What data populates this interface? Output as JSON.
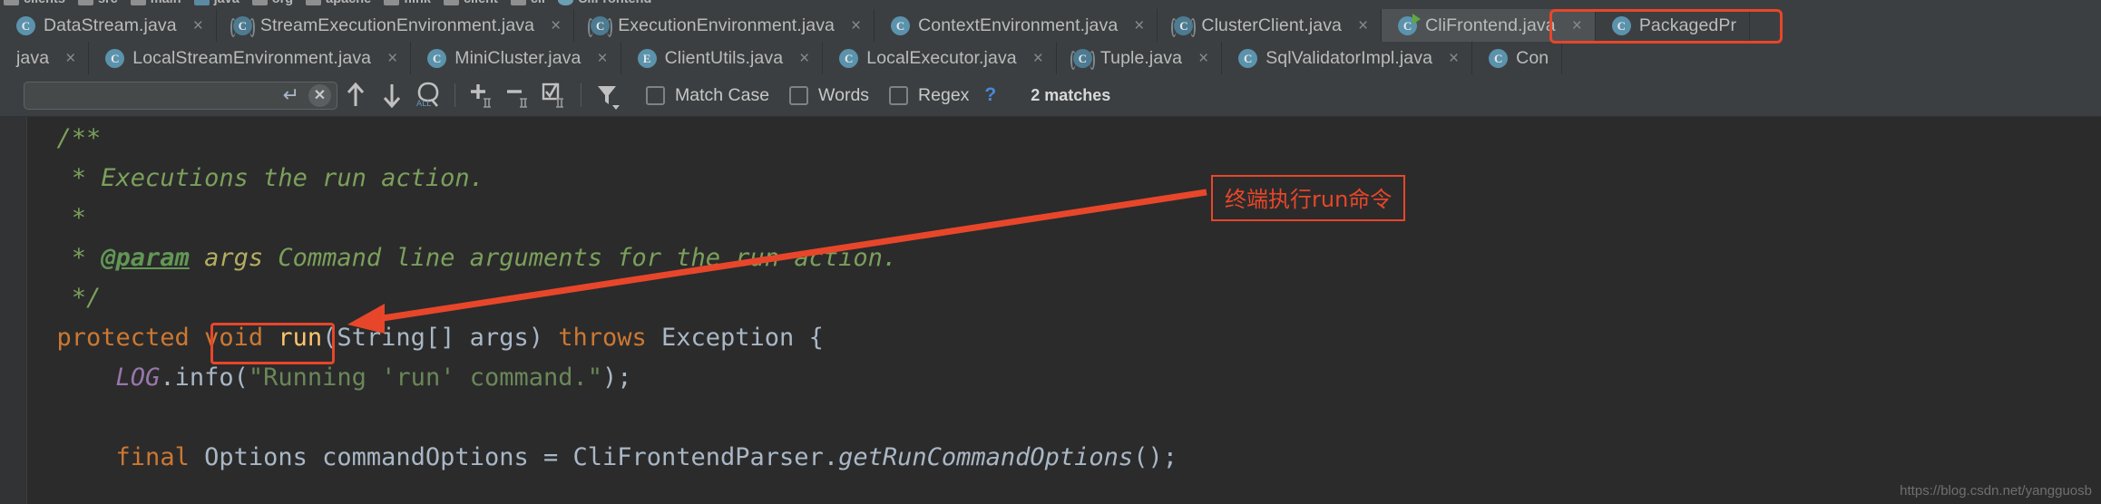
{
  "breadcrumb": {
    "items": [
      {
        "label": "clients",
        "icon": "folder-icon",
        "kind": "module"
      },
      {
        "label": "src",
        "icon": "folder-icon",
        "kind": "plain"
      },
      {
        "label": "main",
        "icon": "folder-icon",
        "kind": "plain"
      },
      {
        "label": "java",
        "icon": "source-folder-icon",
        "kind": "source"
      },
      {
        "label": "org",
        "icon": "folder-icon",
        "kind": "plain"
      },
      {
        "label": "apache",
        "icon": "folder-icon",
        "kind": "plain"
      },
      {
        "label": "flink",
        "icon": "folder-icon",
        "kind": "plain"
      },
      {
        "label": "client",
        "icon": "folder-icon",
        "kind": "plain"
      },
      {
        "label": "cli",
        "icon": "folder-icon",
        "kind": "plain"
      },
      {
        "label": "CliFrontend",
        "icon": "class-icon",
        "kind": "class"
      }
    ]
  },
  "tabs": {
    "row1": [
      {
        "label": "DataStream.java",
        "icon": "class-icon",
        "type": "class",
        "active": false,
        "close": "×"
      },
      {
        "label": "StreamExecutionEnvironment.java",
        "icon": "abstract-class-icon",
        "type": "abstract",
        "active": false,
        "close": "×"
      },
      {
        "label": "ExecutionEnvironment.java",
        "icon": "abstract-class-icon",
        "type": "abstract",
        "active": false,
        "close": "×"
      },
      {
        "label": "ContextEnvironment.java",
        "icon": "class-icon",
        "type": "class",
        "active": false,
        "close": "×"
      },
      {
        "label": "ClusterClient.java",
        "icon": "abstract-class-icon",
        "type": "abstract",
        "active": false,
        "close": "×"
      },
      {
        "label": "CliFrontend.java",
        "icon": "runnable-class-icon",
        "type": "runnable",
        "active": true,
        "close": "×"
      },
      {
        "label": "PackagedPr",
        "icon": "class-icon",
        "type": "class",
        "active": false,
        "close": ""
      }
    ],
    "row2": [
      {
        "label": "java",
        "icon": "none",
        "type": "none",
        "active": false,
        "close": "×"
      },
      {
        "label": "LocalStreamEnvironment.java",
        "icon": "class-icon",
        "type": "class",
        "active": false,
        "close": "×"
      },
      {
        "label": "MiniCluster.java",
        "icon": "class-icon",
        "type": "class",
        "active": false,
        "close": "×"
      },
      {
        "label": "ClientUtils.java",
        "icon": "enum-icon",
        "type": "enum",
        "active": false,
        "close": "×"
      },
      {
        "label": "LocalExecutor.java",
        "icon": "class-icon",
        "type": "class",
        "active": false,
        "close": "×"
      },
      {
        "label": "Tuple.java",
        "icon": "abstract-class-icon",
        "type": "abstract",
        "active": false,
        "close": "×"
      },
      {
        "label": "SqlValidatorImpl.java",
        "icon": "class-icon",
        "type": "class",
        "active": false,
        "close": "×"
      },
      {
        "label": "Con",
        "icon": "class-icon",
        "type": "class",
        "active": false,
        "close": ""
      }
    ]
  },
  "findbar": {
    "search_value": "",
    "enter_icon": "↵",
    "clear_icon": "✕",
    "prev_icon": "arrow-up-icon",
    "next_icon": "arrow-down-icon",
    "select_all_icon": "select-all-occurrences-icon",
    "add_caret_icon": "add-selection-icon",
    "remove_caret_icon": "remove-selection-icon",
    "select_all_carets_icon": "select-all-carets-icon",
    "filter_icon": "filter-icon",
    "match_case_label": "Match Case",
    "words_label": "Words",
    "regex_label": "Regex",
    "help_label": "?",
    "match_count": "2 matches"
  },
  "code": {
    "lines": [
      [
        {
          "t": "  /**",
          "c": "cm"
        }
      ],
      [
        {
          "t": "   * Executions the run action.",
          "c": "cm"
        }
      ],
      [
        {
          "t": "   *",
          "c": "cm"
        }
      ],
      [
        {
          "t": "   * ",
          "c": "cm"
        },
        {
          "t": "@param",
          "c": "cm-tag"
        },
        {
          "t": " ",
          "c": "cm"
        },
        {
          "t": "args",
          "c": "cm-param"
        },
        {
          "t": " Command line arguments for the run action.",
          "c": "cm"
        }
      ],
      [
        {
          "t": "   */",
          "c": "cm"
        }
      ],
      [
        {
          "t": "  protected void ",
          "c": "kw"
        },
        {
          "t": "run",
          "c": "mth"
        },
        {
          "t": "(String[] args) ",
          "c": "id"
        },
        {
          "t": "throws ",
          "c": "kw"
        },
        {
          "t": "Exception {",
          "c": "id"
        }
      ],
      [
        {
          "t": "      ",
          "c": "id"
        },
        {
          "t": "LOG",
          "c": "fld"
        },
        {
          "t": ".info(",
          "c": "id"
        },
        {
          "t": "\"Running 'run' command.\"",
          "c": "str"
        },
        {
          "t": ");",
          "c": "id"
        }
      ],
      [
        {
          "t": "",
          "c": "id"
        }
      ],
      [
        {
          "t": "      ",
          "c": "id"
        },
        {
          "t": "final ",
          "c": "kw"
        },
        {
          "t": "Options commandOptions = CliFrontendParser.",
          "c": "id"
        },
        {
          "t": "getRunCommandOptions",
          "c": "call"
        },
        {
          "t": "();",
          "c": "id"
        }
      ]
    ]
  },
  "annotations": {
    "chinese_note": "终端执行run命令",
    "highlight_tab": "CliFrontend.java",
    "highlight_method": "run",
    "accent_color": "#e8462a"
  },
  "watermark": "https://blog.csdn.net/yangguosb"
}
